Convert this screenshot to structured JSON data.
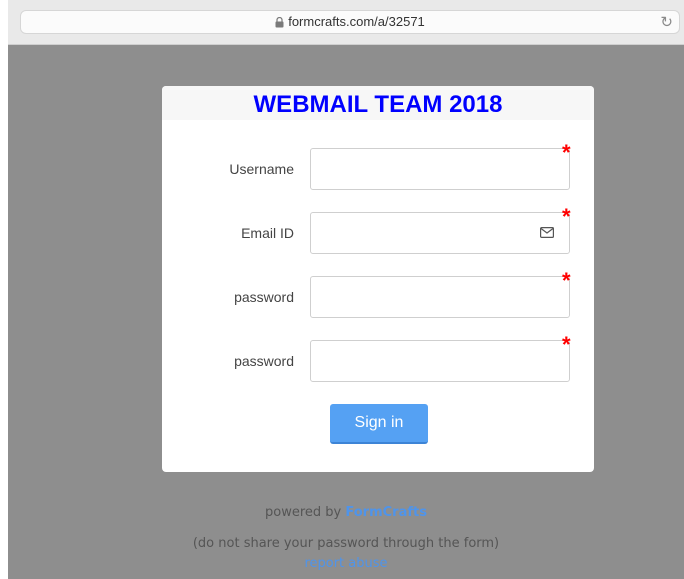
{
  "browser": {
    "url": "formcrafts.com/a/32571"
  },
  "form": {
    "title": "WEBMAIL TEAM 2018",
    "fields": [
      {
        "label": "Username",
        "value": "",
        "required_mark": "*"
      },
      {
        "label": "Email ID",
        "value": "",
        "required_mark": "*"
      },
      {
        "label": "password",
        "value": "",
        "required_mark": "*"
      },
      {
        "label": "password",
        "value": "",
        "required_mark": "*"
      }
    ],
    "submit_label": "Sign in"
  },
  "footer": {
    "powered_prefix": "powered by",
    "powered_brand": "FormCrafts",
    "note": "(do not share your password through the form)",
    "report_link": "report abuse"
  },
  "colors": {
    "title": "#0000ff",
    "required": "#ff0000",
    "button": "#55a1f3",
    "link": "#4f94ea",
    "background": "#8e8e8e"
  }
}
